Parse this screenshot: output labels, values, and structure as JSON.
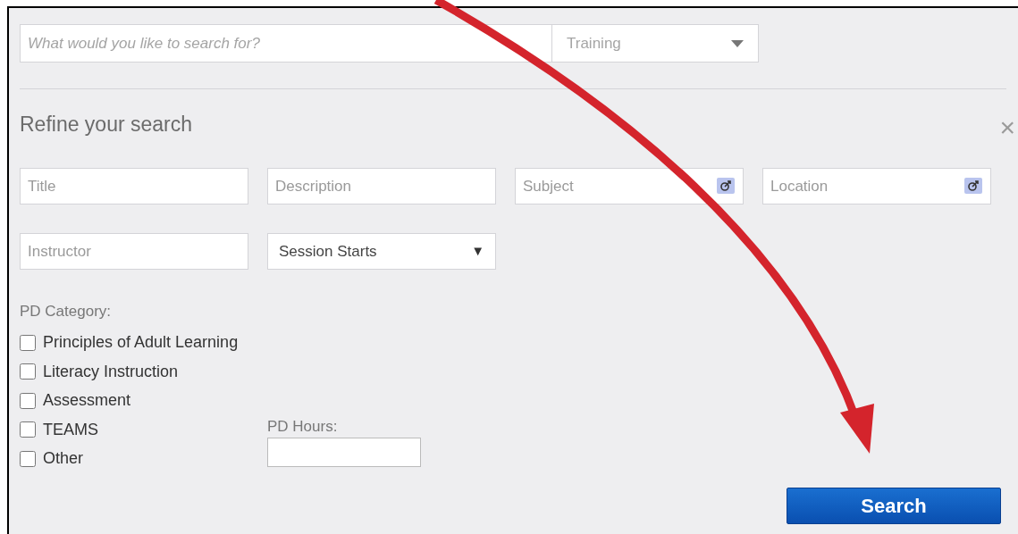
{
  "search": {
    "placeholder": "What would you like to search for?",
    "category": "Training"
  },
  "refine": {
    "title": "Refine your search",
    "close": "×"
  },
  "fields": [
    {
      "kind": "text",
      "placeholder": "Title"
    },
    {
      "kind": "text",
      "placeholder": "Description"
    },
    {
      "kind": "lookup",
      "placeholder": "Subject"
    },
    {
      "kind": "lookup",
      "placeholder": "Location"
    },
    {
      "kind": "text",
      "placeholder": "Instructor"
    },
    {
      "kind": "select",
      "value": "Session Starts",
      "caret": "▼"
    }
  ],
  "pd_category": {
    "label": "PD Category:",
    "options": [
      {
        "label": "Principles of Adult Learning",
        "checked": false
      },
      {
        "label": "Literacy Instruction",
        "checked": false
      },
      {
        "label": "Assessment",
        "checked": false
      },
      {
        "label": "TEAMS",
        "checked": false
      },
      {
        "label": "Other",
        "checked": false
      }
    ]
  },
  "pd_hours": {
    "label": "PD Hours:"
  },
  "search_button": "Search"
}
